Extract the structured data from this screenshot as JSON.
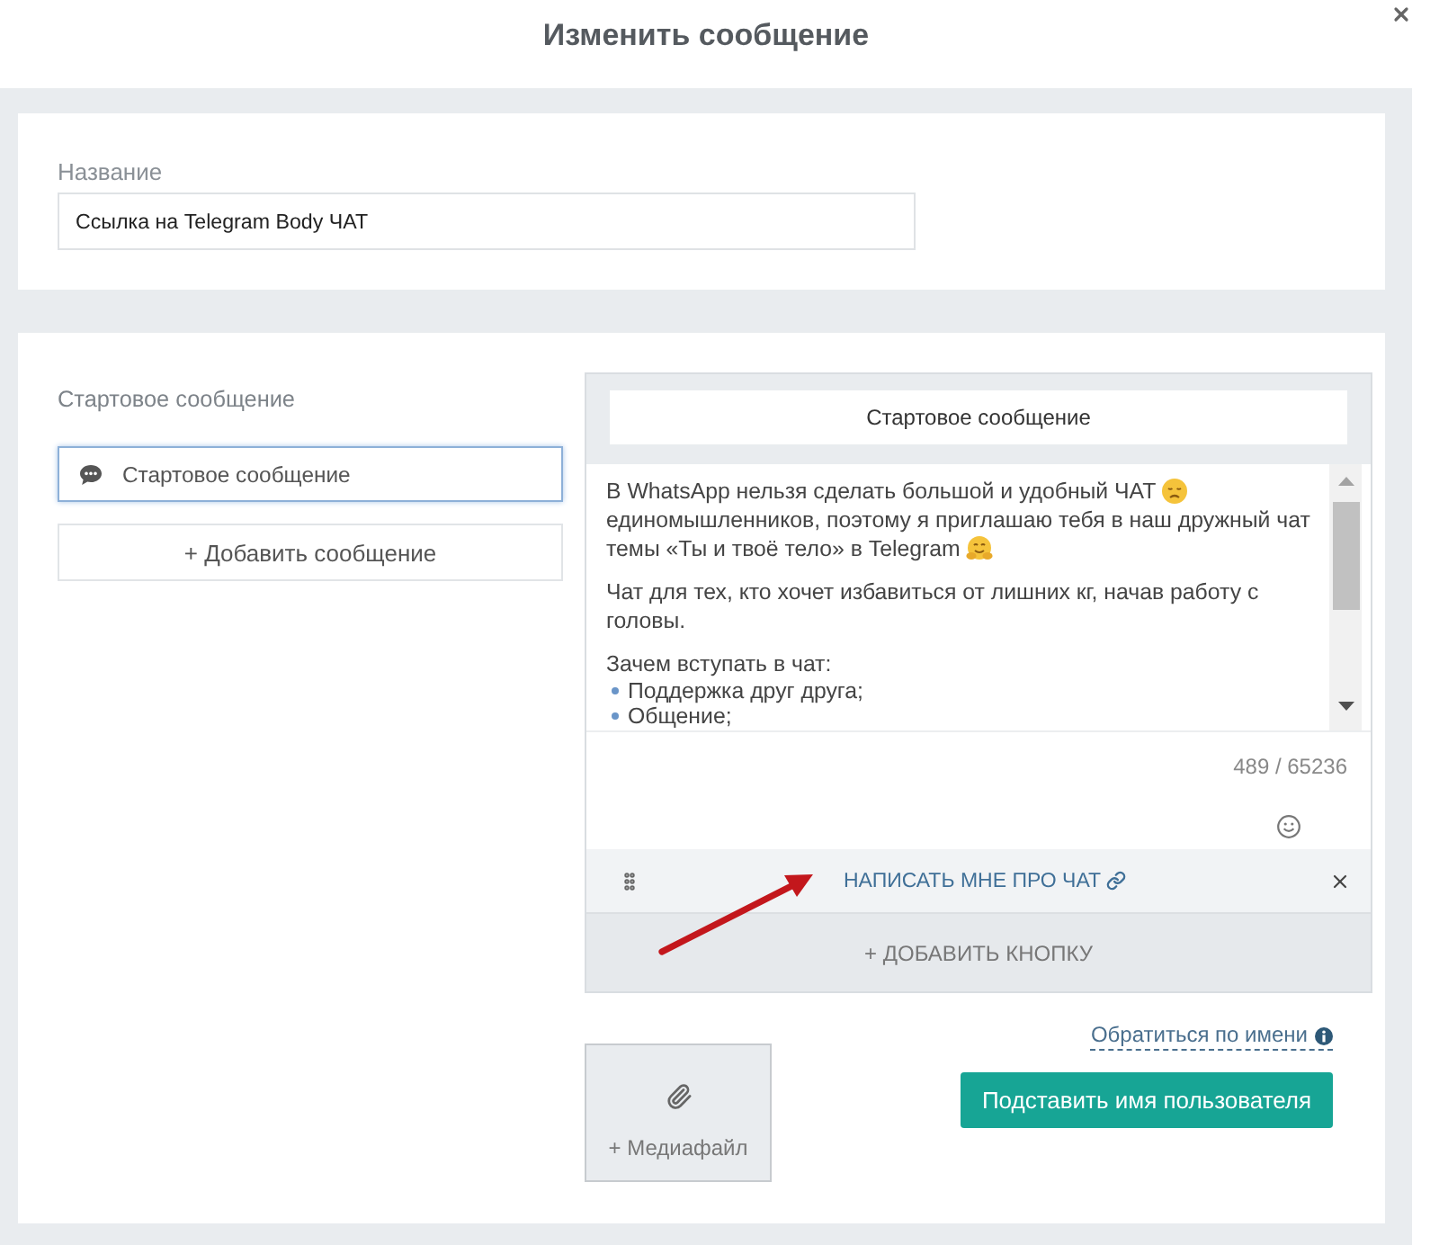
{
  "dialog": {
    "title": "Изменить сообщение"
  },
  "name_field": {
    "label": "Название",
    "value": "Ссылка на Telegram Body ЧАТ"
  },
  "messages": {
    "label": "Стартовое сообщение",
    "items": [
      {
        "label": "Стартовое сообщение",
        "selected": true
      }
    ],
    "add_button": "+ Добавить сообщение"
  },
  "editor": {
    "title": "Стартовое сообщение",
    "paragraphs": [
      {
        "lines": [
          {
            "text": "В WhatsApp нельзя сделать большой и удобный ЧАТ",
            "kind": "sad_emoji"
          },
          {
            "text": "единомышленников, поэтому я приглашаю тебя в наш дружный чат",
            "kind": "plain"
          },
          {
            "text": "темы «Ты и твоё тело» в Telegram",
            "kind": "hug_emoji"
          }
        ]
      },
      {
        "lines": [
          {
            "text": "Чат для тех, кто хочет избавиться от лишних кг, начав работу с",
            "kind": "plain"
          },
          {
            "text": "головы.",
            "kind": "plain"
          }
        ]
      },
      {
        "lines": [
          {
            "text": "Зачем вступать в чат:",
            "kind": "plain"
          }
        ],
        "bullets": [
          "Поддержка друг друга;",
          "Общение;"
        ]
      }
    ],
    "counter": "489 / 65236",
    "buttons": [
      {
        "label": "НАПИСАТЬ МНЕ ПРО ЧАТ",
        "kind": "link"
      }
    ],
    "add_button": "+ ДОБАВИТЬ КНОПКУ"
  },
  "media_button": {
    "label": "+ Медиафайл"
  },
  "personalization": {
    "link": "Обратиться по имени",
    "button": "Подставить имя пользователя"
  }
}
